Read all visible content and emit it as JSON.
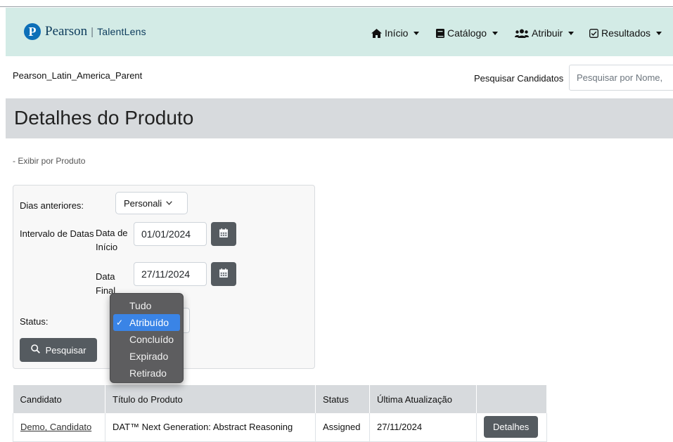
{
  "brand": {
    "name": "Pearson",
    "separator": "|",
    "sub": "TalentLens",
    "logo_letter": "P"
  },
  "nav": [
    {
      "label": "Início",
      "icon": "home-icon"
    },
    {
      "label": "Catálogo",
      "icon": "book-icon"
    },
    {
      "label": "Atribuir",
      "icon": "users-icon"
    },
    {
      "label": "Resultados",
      "icon": "check-square-icon"
    }
  ],
  "org_name": "Pearson_Latin_America_Parent",
  "search": {
    "label": "Pesquisar Candidatos",
    "placeholder": "Pesquisar por Nome,"
  },
  "page_title": "Detalhes do Produto",
  "view_link": "- Exibir por Produto",
  "filters": {
    "days_label": "Dias anteriores:",
    "days_value": "Personali",
    "range_label": "Intervalo de Datas",
    "start_label": "Data de Início",
    "start_value": "01/01/2024",
    "end_label": "Data Final",
    "end_value": "27/11/2024",
    "status_label": "Status:",
    "search_button": "Pesquisar"
  },
  "status_dropdown": {
    "options": [
      "Tudo",
      "Atribuído",
      "Concluído",
      "Expirado",
      "Retirado"
    ],
    "selected": "Atribuído",
    "check": "✓"
  },
  "table": {
    "headers": [
      "Candidato",
      "Título do Produto",
      "Status",
      "Última Atualização",
      ""
    ],
    "rows": [
      {
        "candidate": "Demo, Candidato",
        "product": "DAT™ Next Generation: Abstract Reasoning",
        "status": "Assigned",
        "updated": "27/11/2024",
        "action": "Detalhes"
      }
    ]
  },
  "colors": {
    "navbar": "#d3ebe6",
    "titlebar": "#d7dadd",
    "button": "#555b60",
    "dropdown_selected": "#3a84e6",
    "logo": "#0d6fb8"
  }
}
